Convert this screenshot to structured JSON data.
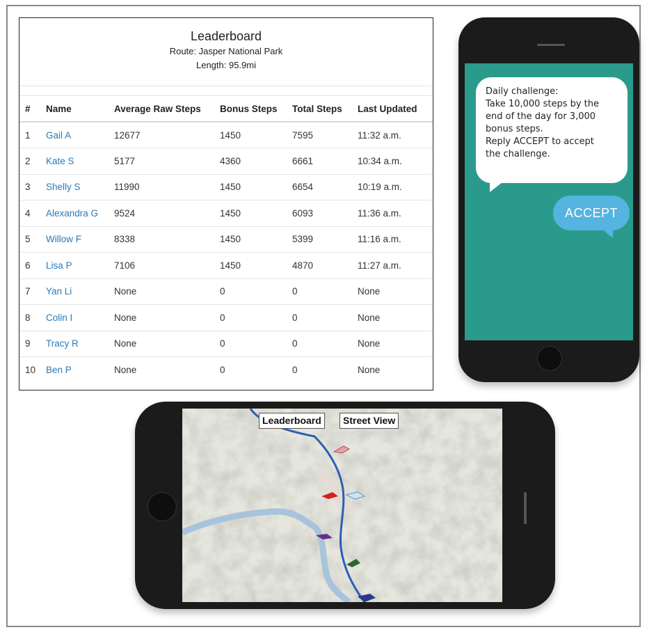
{
  "leaderboard": {
    "title": "Leaderboard",
    "route": "Route: Jasper National Park",
    "length": "Length: 95.9mi",
    "headers": [
      "#",
      "Name",
      "Average Raw Steps",
      "Bonus Steps",
      "Total Steps",
      "Last Updated"
    ],
    "rows": [
      [
        "1",
        "Gail A",
        "12677",
        "1450",
        "7595",
        "11:32 a.m."
      ],
      [
        "2",
        "Kate S",
        "5177",
        "4360",
        "6661",
        "10:34 a.m."
      ],
      [
        "3",
        "Shelly S",
        "11990",
        "1450",
        "6654",
        "10:19 a.m."
      ],
      [
        "4",
        "Alexandra G",
        "9524",
        "1450",
        "6093",
        "11:36 a.m."
      ],
      [
        "5",
        "Willow F",
        "8338",
        "1450",
        "5399",
        "11:16 a.m."
      ],
      [
        "6",
        "Lisa P",
        "7106",
        "1450",
        "4870",
        "11:27 a.m."
      ],
      [
        "7",
        "Yan Li",
        "None",
        "0",
        "0",
        "None"
      ],
      [
        "8",
        "Colin I",
        "None",
        "0",
        "0",
        "None"
      ],
      [
        "9",
        "Tracy R",
        "None",
        "0",
        "0",
        "None"
      ],
      [
        "10",
        "Ben P",
        "None",
        "0",
        "0",
        "None"
      ]
    ]
  },
  "sms": {
    "message_lines": [
      "Daily challenge:",
      "Take 10,000 steps by the",
      "end of the day for 3,000",
      "bonus steps.",
      "Reply ACCEPT to accept",
      "the challenge."
    ],
    "reply": "ACCEPT",
    "screen_color": "#2a9a8c",
    "reply_color": "#55b4e0"
  },
  "map": {
    "leaderboard_button": "Leaderboard",
    "street_view_button": "Street View",
    "route_color": "#2b5fb5",
    "walker_colors": [
      "#e8a0a8",
      "#d42020",
      "#88c0e0",
      "#6a2a8a",
      "#2a6a2a",
      "#2a3a8a"
    ]
  }
}
